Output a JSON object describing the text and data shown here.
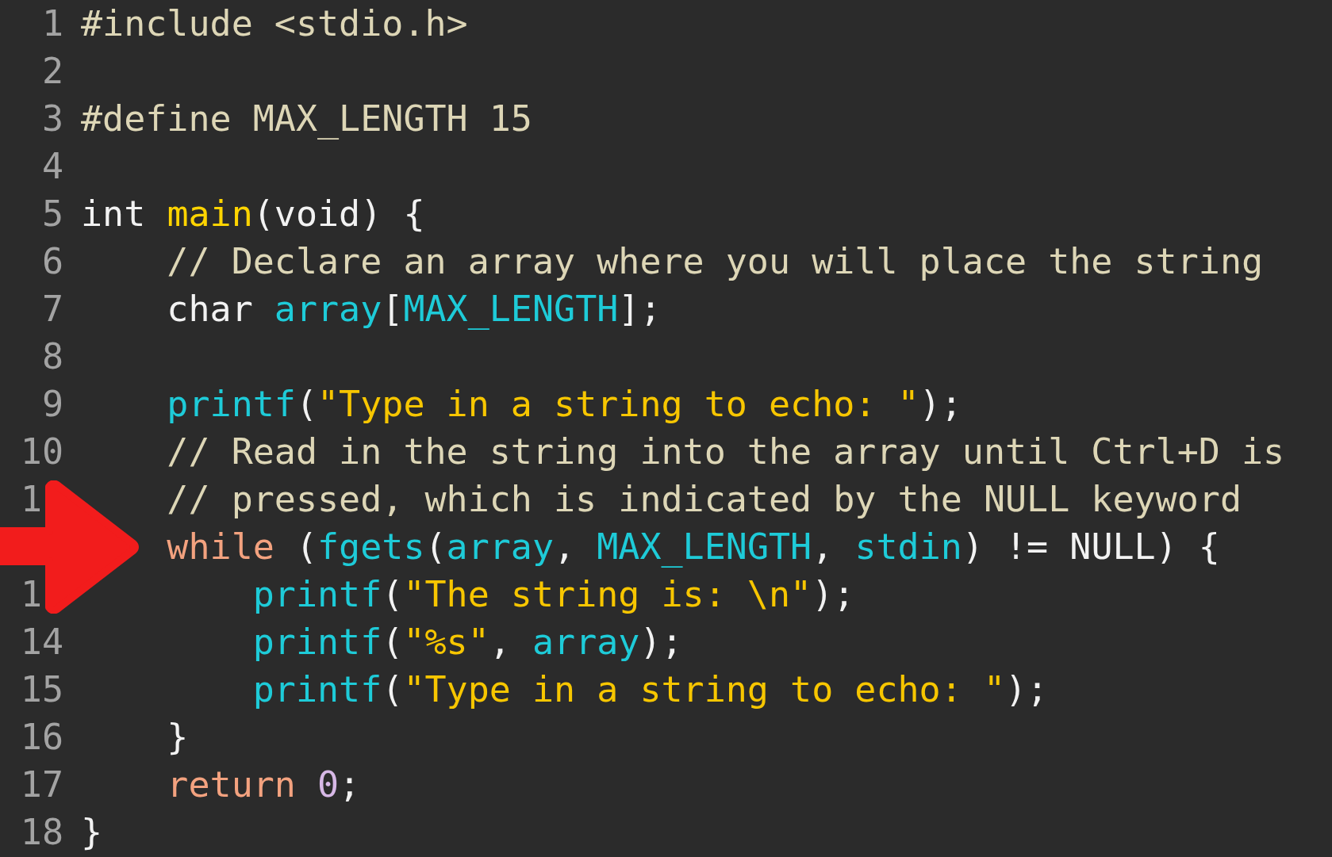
{
  "editor": {
    "lines": [
      {
        "number": "1",
        "tokens": [
          {
            "text": "#include <stdio.h>",
            "kind": "preprocessor"
          }
        ]
      },
      {
        "number": "2"
      },
      {
        "number": "3",
        "tokens": [
          {
            "text": "#define MAX_LENGTH 15",
            "kind": "preprocessor"
          }
        ]
      },
      {
        "number": "4"
      },
      {
        "number": "5",
        "tokens": [
          {
            "text": "int ",
            "kind": "plain"
          },
          {
            "text": "main",
            "kind": "function-name"
          },
          {
            "text": "(void) {",
            "kind": "plain"
          }
        ]
      },
      {
        "number": "6",
        "tokens": [
          {
            "text": "    // Declare an array where you will place the string",
            "kind": "comment"
          }
        ]
      },
      {
        "number": "7",
        "tokens": [
          {
            "text": "    char ",
            "kind": "plain"
          },
          {
            "text": "array",
            "kind": "identifier"
          },
          {
            "text": "[",
            "kind": "plain"
          },
          {
            "text": "MAX_LENGTH",
            "kind": "identifier"
          },
          {
            "text": "];",
            "kind": "plain"
          }
        ]
      },
      {
        "number": "8"
      },
      {
        "number": "9",
        "tokens": [
          {
            "text": "    printf",
            "kind": "identifier"
          },
          {
            "text": "(",
            "kind": "plain"
          },
          {
            "text": "\"Type in a string to echo: \"",
            "kind": "string"
          },
          {
            "text": ");",
            "kind": "plain"
          }
        ]
      },
      {
        "number": "10",
        "tokens": [
          {
            "text": "    // Read in the string into the array until Ctrl+D is",
            "kind": "comment"
          }
        ]
      },
      {
        "number": "1",
        "covered": true,
        "tokens": [
          {
            "text": "    // pressed, which is indicated by the NULL keyword",
            "kind": "comment"
          }
        ]
      },
      {
        "tokens": [
          {
            "text": "    while",
            "kind": "keyword"
          },
          {
            "text": " (",
            "kind": "plain"
          },
          {
            "text": "fgets",
            "kind": "identifier"
          },
          {
            "text": "(",
            "kind": "plain"
          },
          {
            "text": "array",
            "kind": "identifier"
          },
          {
            "text": ", ",
            "kind": "plain"
          },
          {
            "text": "MAX_LENGTH",
            "kind": "identifier"
          },
          {
            "text": ", ",
            "kind": "plain"
          },
          {
            "text": "stdin",
            "kind": "identifier"
          },
          {
            "text": ") != NULL) {",
            "kind": "plain"
          }
        ]
      },
      {
        "number": "1",
        "covered": true,
        "tokens": [
          {
            "text": "        printf",
            "kind": "identifier"
          },
          {
            "text": "(",
            "kind": "plain"
          },
          {
            "text": "\"The string is: \\n\"",
            "kind": "string"
          },
          {
            "text": ");",
            "kind": "plain"
          }
        ]
      },
      {
        "number": "14",
        "tokens": [
          {
            "text": "        printf",
            "kind": "identifier"
          },
          {
            "text": "(",
            "kind": "plain"
          },
          {
            "text": "\"%s\"",
            "kind": "string"
          },
          {
            "text": ", ",
            "kind": "plain"
          },
          {
            "text": "array",
            "kind": "identifier"
          },
          {
            "text": ");",
            "kind": "plain"
          }
        ]
      },
      {
        "number": "15",
        "tokens": [
          {
            "text": "        printf",
            "kind": "identifier"
          },
          {
            "text": "(",
            "kind": "plain"
          },
          {
            "text": "\"Type in a string to echo: \"",
            "kind": "string"
          },
          {
            "text": ");",
            "kind": "plain"
          }
        ]
      },
      {
        "number": "16",
        "tokens": [
          {
            "text": "    }",
            "kind": "plain"
          }
        ]
      },
      {
        "number": "17",
        "tokens": [
          {
            "text": "    return ",
            "kind": "keyword"
          },
          {
            "text": "0",
            "kind": "number"
          },
          {
            "text": ";",
            "kind": "plain"
          }
        ]
      },
      {
        "number": "18",
        "tokens": [
          {
            "text": "}",
            "kind": "plain"
          }
        ]
      }
    ]
  }
}
